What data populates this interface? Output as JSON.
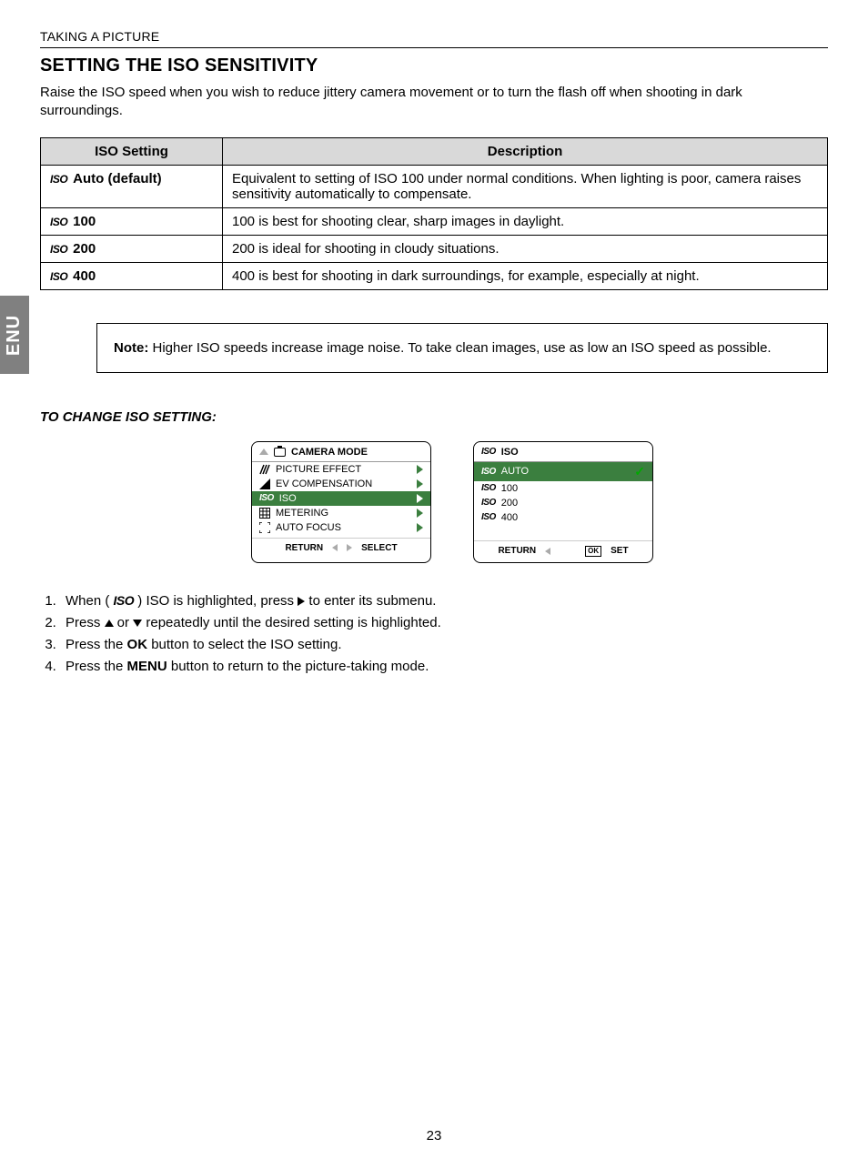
{
  "side_tab": "ENU",
  "breadcrumb": "TAKING A PICTURE",
  "section_title": "SETTING THE ISO SENSITIVITY",
  "intro": "Raise the ISO speed when you wish to reduce jittery camera movement or to turn the flash off when shooting in dark surroundings.",
  "table": {
    "headers": {
      "setting": "ISO Setting",
      "description": "Description"
    },
    "rows": [
      {
        "setting": "Auto (default)",
        "description": "Equivalent to setting of ISO 100 under normal conditions. When lighting is poor, camera raises sensitivity automatically to compensate."
      },
      {
        "setting": "100",
        "description": "100 is best for shooting clear, sharp images in daylight."
      },
      {
        "setting": "200",
        "description": "200 is ideal for shooting in cloudy situations."
      },
      {
        "setting": "400",
        "description": "400 is best for shooting in dark surroundings, for example, especially at night."
      }
    ]
  },
  "note": {
    "label": "Note:",
    "text": " Higher ISO speeds increase image noise. To take clean images, use as low an ISO speed as possible."
  },
  "subhead": "TO CHANGE ISO SETTING:",
  "screen1": {
    "title": "CAMERA MODE",
    "items": [
      {
        "label": "PICTURE EFFECT"
      },
      {
        "label": "EV COMPENSATION"
      },
      {
        "label": "ISO",
        "selected": true
      },
      {
        "label": "METERING"
      },
      {
        "label": "AUTO FOCUS"
      }
    ],
    "footer": {
      "return": "RETURN",
      "select": "SELECT"
    }
  },
  "screen2": {
    "title": "ISO",
    "items": [
      {
        "label": "AUTO",
        "selected": true,
        "checked": true
      },
      {
        "label": "100"
      },
      {
        "label": "200"
      },
      {
        "label": "400"
      }
    ],
    "footer": {
      "return": "RETURN",
      "ok": "OK",
      "set": "SET"
    }
  },
  "steps": {
    "s1a": "When ( ",
    "s1b": " ) ISO is highlighted, press ",
    "s1c": " to enter its submenu.",
    "s2a": "Press ",
    "s2b": " or ",
    "s2c": " repeatedly until the desired setting is highlighted.",
    "s3a": "Press the ",
    "s3b": "OK",
    "s3c": " button to select the ISO setting.",
    "s4a": "Press the ",
    "s4b": "MENU",
    "s4c": " button to return to the picture-taking mode."
  },
  "page_number": "23",
  "iso_icon_text": "ISO"
}
